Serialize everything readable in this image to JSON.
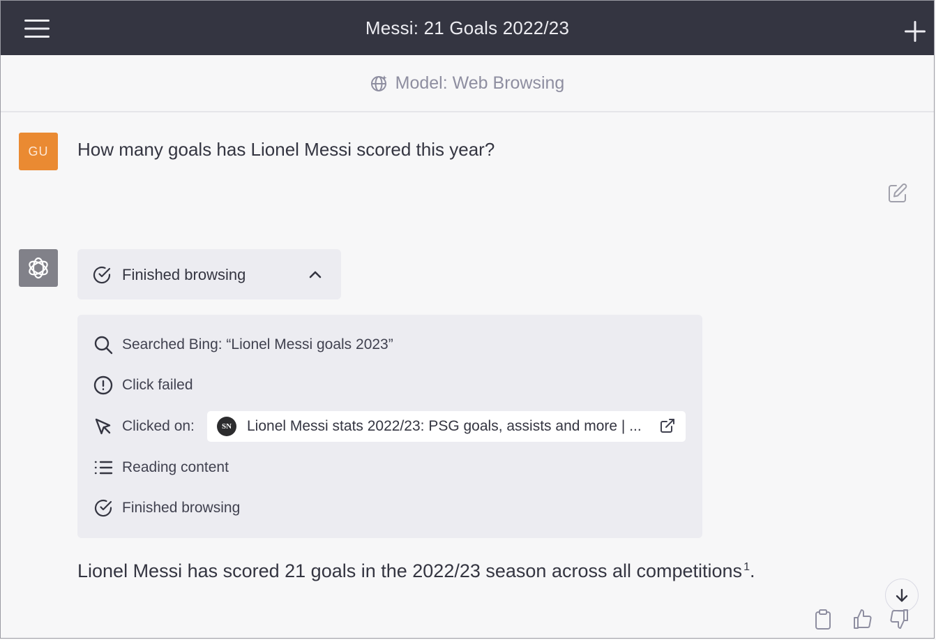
{
  "header": {
    "title": "Messi: 21 Goals 2022/23",
    "menu_icon": "hamburger-menu-icon",
    "new_chat_icon": "plus-icon"
  },
  "model_bar": {
    "label": "Model: Web Browsing",
    "icon": "globe-sparkle-icon"
  },
  "user_message": {
    "avatar_initials": "GU",
    "avatar_color": "#ea8a32",
    "text": "How many goals has Lionel Messi scored this year?",
    "edit_icon": "edit-icon"
  },
  "assistant_message": {
    "avatar_icon": "openai-logo-icon",
    "browsing_toggle": {
      "label": "Finished browsing",
      "expanded": true
    },
    "steps": [
      {
        "icon": "search-icon",
        "text": "Searched Bing: “Lionel Messi goals 2023”"
      },
      {
        "icon": "alert-circle-icon",
        "text": "Click failed"
      },
      {
        "icon": "cursor-icon",
        "text": "Clicked on:",
        "link": {
          "favicon_text": "SN",
          "title": "Lionel Messi stats 2022/23: PSG goals, assists and more | ..."
        }
      },
      {
        "icon": "list-icon",
        "text": "Reading content"
      },
      {
        "icon": "check-circle-icon",
        "text": "Finished browsing"
      }
    ],
    "answer_text": "Lionel Messi has scored 21 goals in the 2022/23 season across all competitions",
    "answer_citation": "1",
    "answer_end": ".",
    "actions": [
      "clipboard-icon",
      "thumbs-up-icon",
      "thumbs-down-icon"
    ]
  },
  "colors": {
    "topbar_bg": "#343541",
    "page_bg": "#f7f7f8",
    "panel_bg": "#ececf1"
  }
}
